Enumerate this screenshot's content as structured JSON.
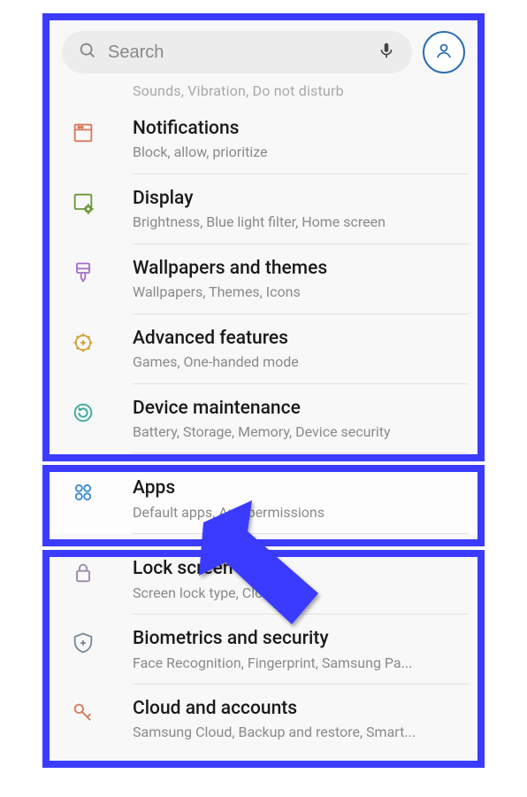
{
  "search": {
    "placeholder": "Search"
  },
  "truncated_prev": "Sounds, Vibration, Do not disturb",
  "items": [
    {
      "title": "Notifications",
      "sub": "Block, allow, prioritize"
    },
    {
      "title": "Display",
      "sub": "Brightness, Blue light filter, Home screen"
    },
    {
      "title": "Wallpapers and themes",
      "sub": "Wallpapers, Themes, Icons"
    },
    {
      "title": "Advanced features",
      "sub": "Games, One-handed mode"
    },
    {
      "title": "Device maintenance",
      "sub": "Battery, Storage, Memory, Device security"
    },
    {
      "title": "Apps",
      "sub": "Default apps, App permissions"
    },
    {
      "title": "Lock screen",
      "sub": "Screen lock type, Clock style"
    },
    {
      "title": "Biometrics and security",
      "sub": "Face Recognition, Fingerprint, Samsung Pa..."
    },
    {
      "title": "Cloud and accounts",
      "sub": "Samsung Cloud, Backup and restore, Smart..."
    }
  ]
}
